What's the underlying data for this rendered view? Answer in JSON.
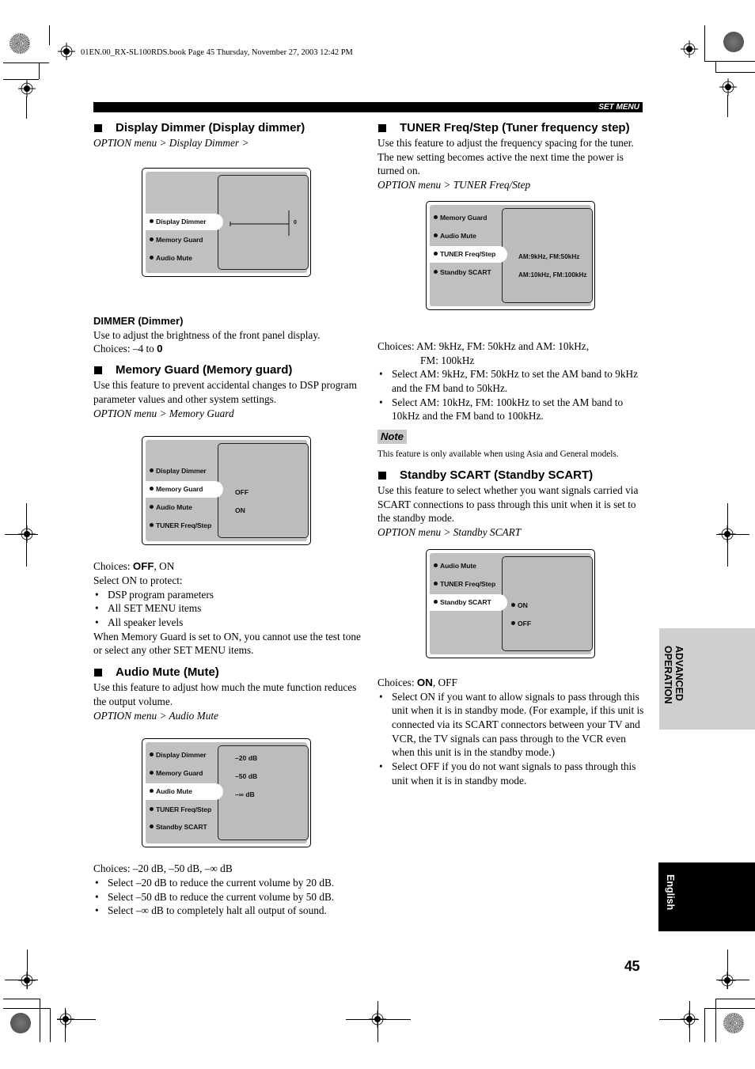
{
  "book_header": "01EN.00_RX-SL100RDS.book  Page 45  Thursday, November 27, 2003  12:42 PM",
  "topbar_label": "SET MENU",
  "sections": {
    "display_dimmer": {
      "title": "Display Dimmer (Display dimmer)",
      "menu_path": "OPTION menu > Display Dimmer >",
      "screen": {
        "menu_items": [
          "Display Dimmer",
          "Memory Guard",
          "Audio Mute"
        ],
        "selected": "Display Dimmer",
        "slider_value_label": "0",
        "slider_level_fraction": 1.0
      },
      "sub_title": "DIMMER (Dimmer)",
      "description": "Use to adjust the brightness of the front panel display.",
      "choices_prefix": "Choices: –4 to ",
      "choices_default": "0"
    },
    "memory_guard": {
      "title": "Memory Guard (Memory guard)",
      "description": "Use this feature to prevent accidental changes to DSP program parameter values and other system settings.",
      "menu_path": "OPTION menu > Memory Guard",
      "screen": {
        "menu_items": [
          "Display Dimmer",
          "Memory Guard",
          "Audio Mute",
          "TUNER Freq/Step"
        ],
        "selected": "Memory Guard",
        "options": [
          "OFF",
          "ON"
        ]
      },
      "choices_prefix": "Choices: ",
      "choices_default": "OFF",
      "choices_rest": ", ON",
      "protect_intro": "Select ON to protect:",
      "protect_items": [
        "DSP program parameters",
        "All SET MENU items",
        "All speaker levels"
      ],
      "closing": "When Memory Guard is set to ON, you cannot use the test tone or select any other SET MENU items."
    },
    "audio_mute": {
      "title": "Audio Mute (Mute)",
      "description": "Use this feature to adjust how much the mute function reduces the output volume.",
      "menu_path": "OPTION menu > Audio Mute",
      "screen": {
        "menu_items": [
          "Display Dimmer",
          "Memory Guard",
          "Audio Mute",
          "TUNER Freq/Step",
          "Standby SCART"
        ],
        "selected": "Audio Mute",
        "options": [
          "–20 dB",
          "–50 dB",
          "–∞ dB"
        ]
      },
      "choices": "Choices: –20 dB, –50 dB, –∞ dB",
      "bullets": [
        "Select –20 dB to reduce the current volume by 20 dB.",
        "Select –50 dB to reduce the current volume by 50 dB.",
        "Select –∞ dB to completely halt all output of sound."
      ]
    },
    "tuner_freq_step": {
      "title": "TUNER Freq/Step (Tuner frequency step)",
      "description": "Use this feature to adjust the frequency spacing for the tuner. The new setting becomes active the next time the power is turned on.",
      "menu_path": "OPTION menu > TUNER Freq/Step",
      "screen": {
        "menu_items": [
          "Memory Guard",
          "Audio Mute",
          "TUNER Freq/Step",
          "Standby SCART"
        ],
        "selected": "TUNER Freq/Step",
        "options": [
          "AM:9kHz,  FM:50kHz",
          "AM:10kHz,  FM:100kHz"
        ]
      },
      "choices_line1": "Choices: AM: 9kHz, FM: 50kHz and AM: 10kHz,",
      "choices_line2": "FM: 100kHz",
      "bullets": [
        "Select AM: 9kHz, FM: 50kHz to set the AM band to 9kHz and the FM band to 50kHz.",
        "Select AM: 10kHz, FM: 100kHz to set the AM band to 10kHz and the FM band to 100kHz."
      ],
      "note_label": "Note",
      "note_text": "This feature is only available when using Asia and General models."
    },
    "standby_scart": {
      "title": "Standby SCART (Standby SCART)",
      "description": "Use this feature to select whether you want signals carried via SCART connections to pass through this unit when it is set to the standby mode.",
      "menu_path": "OPTION menu > Standby SCART",
      "screen": {
        "menu_items": [
          "Audio Mute",
          "TUNER Freq/Step",
          "Standby SCART"
        ],
        "selected": "Standby SCART",
        "options": [
          "ON",
          "OFF"
        ]
      },
      "choices_prefix": "Choices: ",
      "choices_default": "ON",
      "choices_rest": ", OFF",
      "bullets": [
        "Select ON if you want to allow signals to pass through this unit when it is in standby mode. (For example, if this unit is connected via its SCART connectors between your TV and VCR, the TV signals can pass through to the VCR even when this unit is in the standby mode.)",
        "Select OFF if you do not want signals to pass through this unit when it is in standby mode."
      ]
    }
  },
  "side_tabs": {
    "chapter_line1": "ADVANCED",
    "chapter_line2": "OPERATION",
    "language": "English"
  },
  "page_number": "45",
  "colors": {
    "screen_bg": "#c0c0c0",
    "chapter_tab": "#cfcfcf",
    "language_tab": "#000000",
    "note_bg": "#c8c8c8"
  }
}
